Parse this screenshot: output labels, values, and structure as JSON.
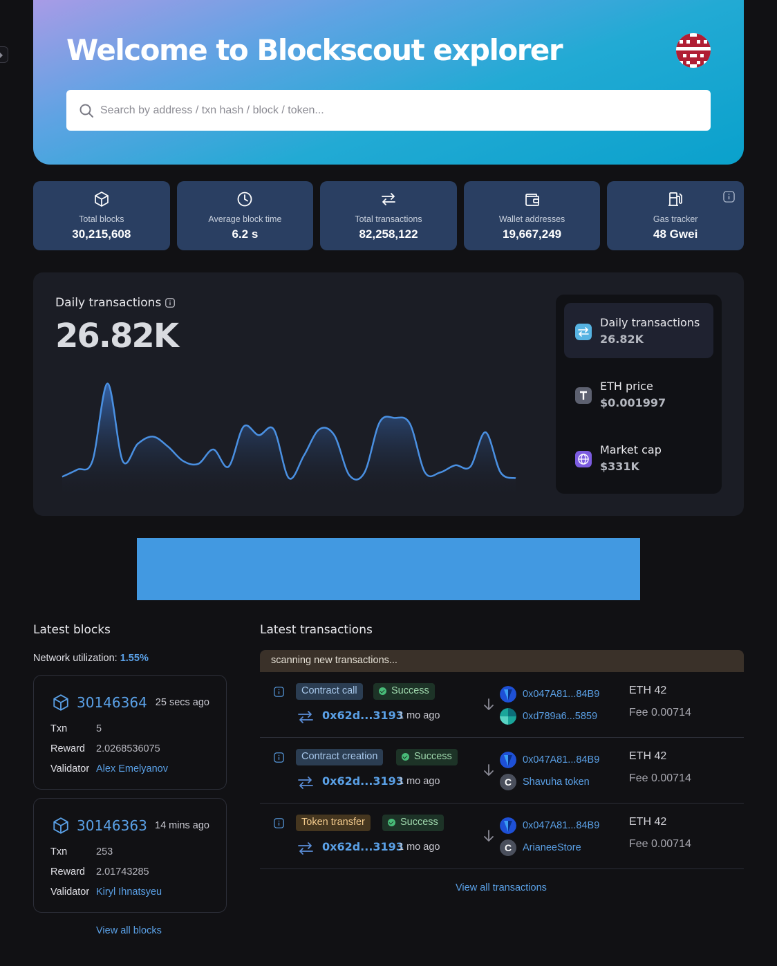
{
  "hero": {
    "title": "Welcome to Blockscout explorer",
    "search_placeholder": "Search by address / txn hash / block / token..."
  },
  "stats": [
    {
      "icon": "cube-icon",
      "label": "Total blocks",
      "value": "30,215,608"
    },
    {
      "icon": "clock-icon",
      "label": "Average block time",
      "value": "6.2 s"
    },
    {
      "icon": "transfer-arrows-icon",
      "label": "Total transactions",
      "value": "82,258,122"
    },
    {
      "icon": "wallet-icon",
      "label": "Wallet addresses",
      "value": "19,667,249"
    },
    {
      "icon": "gas-pump-icon",
      "label": "Gas tracker",
      "value": "48 Gwei"
    }
  ],
  "chart": {
    "title": "Daily transactions",
    "big_value": "26.82K",
    "panel": [
      {
        "icon": "transfer-arrows-icon",
        "label": "Daily transactions",
        "value": "26.82K",
        "color": "#56b3e2"
      },
      {
        "icon": "token-t-icon",
        "label": "ETH price",
        "value": "$0.001997",
        "color": "#5d6170"
      },
      {
        "icon": "globe-icon",
        "label": "Market cap",
        "value": "$331K",
        "color": "#7c5ce0"
      }
    ]
  },
  "chart_data": {
    "type": "area",
    "x": [
      0,
      1,
      2,
      3,
      4,
      5,
      6,
      7,
      8,
      9,
      10,
      11,
      12,
      13,
      14,
      15,
      16,
      17,
      18,
      19,
      20,
      21,
      22,
      23,
      24,
      25,
      26,
      27,
      28,
      29,
      30
    ],
    "values": [
      7,
      12,
      18,
      72,
      18,
      30,
      35,
      28,
      18,
      16,
      26,
      14,
      42,
      36,
      40,
      6,
      22,
      40,
      36,
      8,
      10,
      45,
      48,
      44,
      10,
      10,
      15,
      14,
      38,
      10,
      6
    ],
    "title": "Daily transactions",
    "ylim": [
      0,
      80
    ]
  },
  "latest_blocks": {
    "title": "Latest blocks",
    "network_label": "Network utilization:",
    "network_value": "1.55%",
    "blocks": [
      {
        "number": "30146364",
        "age": "25 secs ago",
        "txn_label": "Txn",
        "txn": "5",
        "reward_label": "Reward",
        "reward": "2.0268536075",
        "validator_label": "Validator",
        "validator": "Alex Emelyanov"
      },
      {
        "number": "30146363",
        "age": "14 mins ago",
        "txn_label": "Txn",
        "txn": "253",
        "reward_label": "Reward",
        "reward": "2.01743285",
        "validator_label": "Validator",
        "validator": "Kiryl Ihnatsyeu"
      }
    ],
    "view_all": "View all blocks"
  },
  "latest_transactions": {
    "title": "Latest transactions",
    "scanning": "scanning new transactions...",
    "items": [
      {
        "type": "Contract call",
        "status": "Success",
        "hash": "0x62d...3193",
        "age": "1 mo ago",
        "from": "0x047A81...84B9",
        "to": "0xd789a6...5859",
        "to_icon": "identicon",
        "eth": "ETH 42",
        "fee_label": "Fee",
        "fee": "0.00714"
      },
      {
        "type": "Contract creation",
        "status": "Success",
        "hash": "0x62d...3193",
        "age": "1 mo ago",
        "from": "0x047A81...84B9",
        "to": "Shavuha token",
        "to_icon": "C",
        "eth": "ETH 42",
        "fee_label": "Fee",
        "fee": "0.00714"
      },
      {
        "type": "Token transfer",
        "status": "Success",
        "hash": "0x62d...3193",
        "age": "1 mo ago",
        "from": "0x047A81...84B9",
        "to": "ArianeeStore",
        "to_icon": "C",
        "eth": "ETH 42",
        "fee_label": "Fee",
        "fee": "0.00714"
      }
    ],
    "view_all": "View all transactions"
  },
  "colors": {
    "accent": "#5aa0e6",
    "stat_card": "#2a3f62",
    "banner": "#4299e1",
    "success": "#48bb78"
  }
}
